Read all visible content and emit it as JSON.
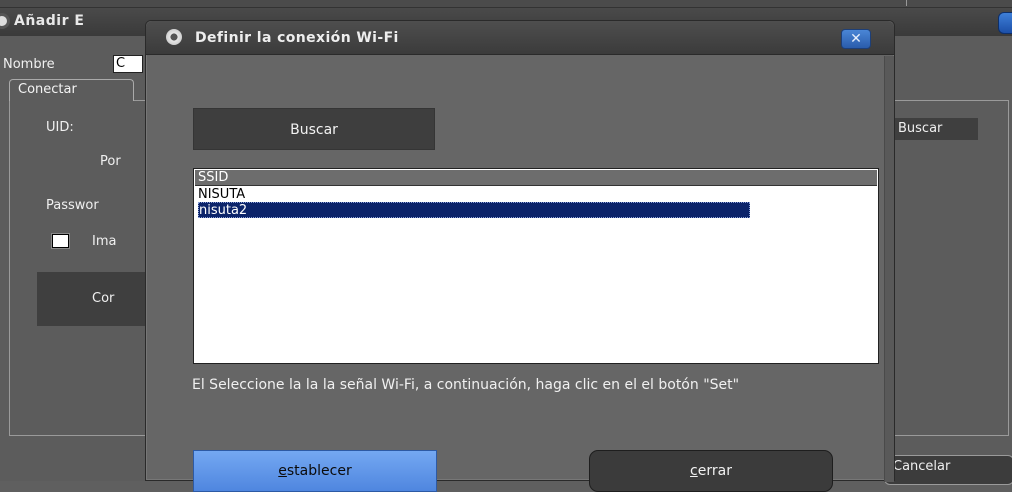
{
  "background": {
    "title": "Añadir E",
    "name_label": "Nombre",
    "name_value": "C",
    "tab_label": "Conectar",
    "uid_label": "UID:",
    "port_label": "Por",
    "password_label": "Passwor",
    "checkbox_label": "Ima",
    "connect_button": "Cor",
    "search_button": "Buscar",
    "cancel_button": "Cancelar"
  },
  "dialog": {
    "title": "Definir la conexión Wi-Fi",
    "close_glyph": "✕",
    "search_button": "Buscar",
    "list": {
      "header": "SSID",
      "rows": [
        "NISUTA",
        "nisuta2"
      ],
      "selected_index": 1
    },
    "instructions": "El Seleccione la la la señal Wi-Fi, a continuación, haga clic en el el botón \"Set\"",
    "set_button": {
      "accel": "e",
      "rest": "stablecer"
    },
    "close_button": {
      "accel": "c",
      "rest": "errar"
    }
  },
  "colors": {
    "set_button": "#5f93e8",
    "selected_row": "#0c246a",
    "title_close": "#3a6fc4"
  },
  "icons": {
    "dialog_title": "wifi-app-icon",
    "background_title": "app-icon",
    "dialog_close": "close-icon"
  }
}
